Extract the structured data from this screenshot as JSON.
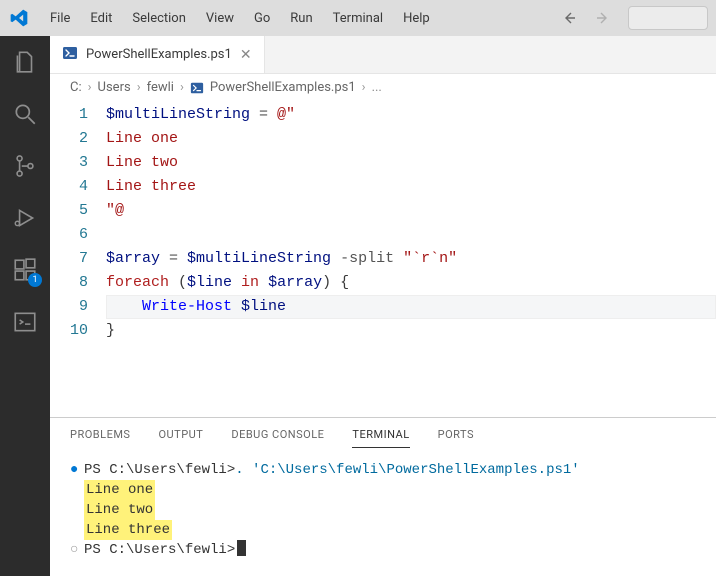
{
  "menubar": [
    "File",
    "Edit",
    "Selection",
    "View",
    "Go",
    "Run",
    "Terminal",
    "Help"
  ],
  "tab": {
    "label": "PowerShellExamples.ps1"
  },
  "breadcrumb": {
    "parts": [
      "C:",
      "Users",
      "fewli",
      "PowerShellExamples.ps1"
    ],
    "more": "..."
  },
  "editor": {
    "lines": [
      {
        "n": "1",
        "tokens": [
          [
            "var",
            "$multiLineString"
          ],
          [
            "op",
            " = "
          ],
          [
            "str",
            "@\""
          ]
        ]
      },
      {
        "n": "2",
        "tokens": [
          [
            "str",
            "Line one"
          ]
        ]
      },
      {
        "n": "3",
        "tokens": [
          [
            "str",
            "Line two"
          ]
        ]
      },
      {
        "n": "4",
        "tokens": [
          [
            "str",
            "Line three"
          ]
        ]
      },
      {
        "n": "5",
        "tokens": [
          [
            "str",
            "\"@"
          ]
        ]
      },
      {
        "n": "6",
        "tokens": []
      },
      {
        "n": "7",
        "tokens": [
          [
            "var",
            "$array"
          ],
          [
            "op",
            " = "
          ],
          [
            "var",
            "$multiLineString"
          ],
          [
            "op",
            " -split "
          ],
          [
            "str",
            "\"`r`n\""
          ]
        ]
      },
      {
        "n": "8",
        "tokens": [
          [
            "kw",
            "foreach"
          ],
          [
            "punc",
            " ("
          ],
          [
            "var",
            "$line"
          ],
          [
            "kw",
            " in "
          ],
          [
            "var",
            "$array"
          ],
          [
            "punc",
            ") {"
          ]
        ]
      },
      {
        "n": "9",
        "tokens": [
          [
            "punc",
            "    "
          ],
          [
            "cmd",
            "Write-Host"
          ],
          [
            "op",
            " "
          ],
          [
            "var",
            "$line"
          ]
        ],
        "active": true
      },
      {
        "n": "10",
        "tokens": [
          [
            "punc",
            "}"
          ]
        ]
      }
    ]
  },
  "panel_tabs": [
    "PROBLEMS",
    "OUTPUT",
    "DEBUG CONSOLE",
    "TERMINAL",
    "PORTS"
  ],
  "panel_active": "TERMINAL",
  "terminal": {
    "prompt1": "PS C:\\Users\\fewli> ",
    "cmd1": ". 'C:\\Users\\fewli\\PowerShellExamples.ps1'",
    "output": [
      "Line one",
      "Line two",
      "Line three"
    ],
    "prompt2": "PS C:\\Users\\fewli> "
  },
  "badge": "1"
}
